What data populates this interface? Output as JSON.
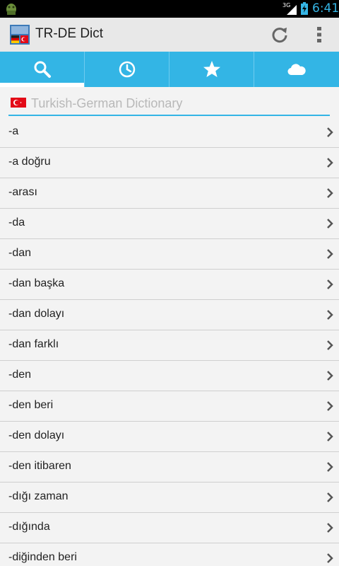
{
  "status_bar": {
    "network": "3G",
    "time": "6:41"
  },
  "action_bar": {
    "title": "TR-DE Dict",
    "icons": [
      "app-icon",
      "refresh-icon",
      "overflow-menu-icon"
    ]
  },
  "tabs": [
    {
      "name": "search",
      "icon": "search-icon",
      "selected": true
    },
    {
      "name": "history",
      "icon": "clock-icon",
      "selected": false
    },
    {
      "name": "favorites",
      "icon": "star-icon",
      "selected": false
    },
    {
      "name": "cloud",
      "icon": "cloud-icon",
      "selected": false
    }
  ],
  "search": {
    "placeholder": "Turkish-German Dictionary",
    "value": "",
    "flag_icon": "turkey-flag-icon"
  },
  "entries": [
    "-a",
    "-a doğru",
    "-arası",
    "-da",
    "-dan",
    "-dan başka",
    "-dan dolayı",
    "-dan farklı",
    "-den",
    "-den beri",
    "-den dolayı",
    "-den itibaren",
    "-dığı zaman",
    "-dığında",
    "-diğinden beri"
  ],
  "colors": {
    "accent": "#33b5e5",
    "background": "#f3f3f3",
    "action_bar": "#e8e8e8"
  }
}
